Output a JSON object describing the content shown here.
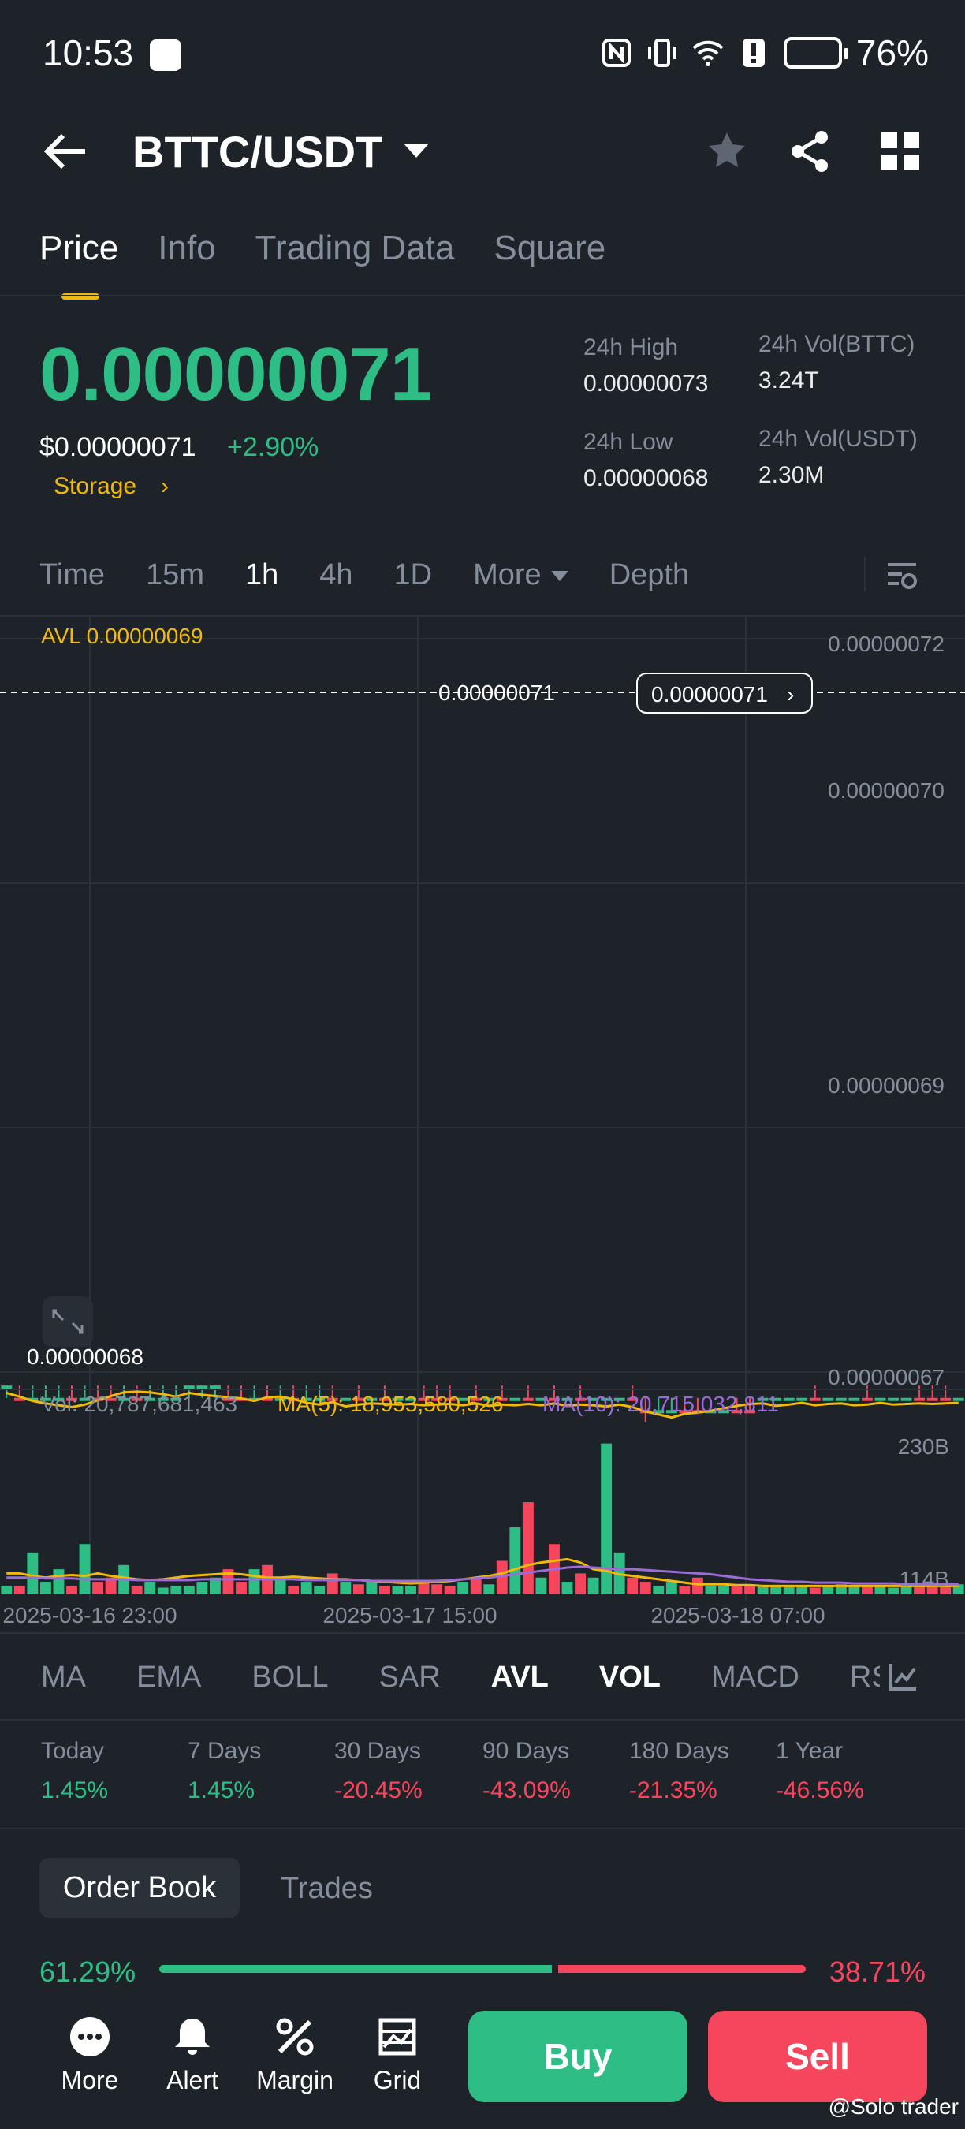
{
  "status_bar": {
    "time": "10:53",
    "battery": "76%"
  },
  "header": {
    "pair": "BTTC/USDT",
    "star_icon": "star-icon",
    "share_icon": "share-icon",
    "grid_icon": "grid-icon"
  },
  "tabs": [
    "Price",
    "Info",
    "Trading Data",
    "Square"
  ],
  "price": {
    "last": "0.00000071",
    "fiat": "$0.00000071",
    "change": "+2.90%",
    "storage": "Storage",
    "high_label": "24h High",
    "high": "0.00000073",
    "low_label": "24h Low",
    "low": "0.00000068",
    "vol_btt_label": "24h Vol(BTTC)",
    "vol_btt": "3.24T",
    "vol_usdt_label": "24h Vol(USDT)",
    "vol_usdt": "2.30M"
  },
  "intervals": [
    "Time",
    "15m",
    "1h",
    "4h",
    "1D",
    "More",
    "Depth"
  ],
  "chart_labels": {
    "avl": "AVL 0.00000069",
    "current_line": "0.00000071",
    "current_tag": "0.00000071",
    "low_marker": "0.00000068",
    "vol": "Vol: 20,787,681,463",
    "ma5": "MA(5): 18,953,580,526",
    "ma10": "MA(10): 20,715,032,811",
    "vol_axis_top": "230B",
    "vol_axis_mid": "114B",
    "x_labels": [
      "2025-03-16 23:00",
      "2025-03-17 15:00",
      "2025-03-18 07:00"
    ],
    "y_labels": [
      "0.00000072",
      "0.00000070",
      "0.00000069",
      "0.00000067"
    ]
  },
  "chart_data": {
    "type": "candlestick",
    "ylim": [
      6.69e-07,
      7.23e-08
    ],
    "levels": {
      "a": 6.8e-07,
      "b": 6.9e-07,
      "c": 7e-07,
      "d": 7.1e-07
    },
    "candles": [
      [
        "a",
        "a",
        "a",
        "b",
        "g"
      ],
      [
        "b",
        "a",
        "a",
        "b",
        "r"
      ],
      [
        "a",
        "b",
        "a",
        "b",
        "g"
      ],
      [
        "a",
        "b",
        "a",
        "b",
        "g"
      ],
      [
        "a",
        "b",
        "a",
        "b",
        "g"
      ],
      [
        "b",
        "a",
        "a",
        "b",
        "r"
      ],
      [
        "b",
        "b",
        "a",
        "b",
        "g"
      ],
      [
        "b",
        "a",
        "a",
        "b",
        "r"
      ],
      [
        "b",
        "a",
        "a",
        "b",
        "r"
      ],
      [
        "a",
        "b",
        "a",
        "b",
        "g"
      ],
      [
        "b",
        "a",
        "a",
        "b",
        "r"
      ],
      [
        "a",
        "b",
        "a",
        "b",
        "g"
      ],
      [
        "a",
        "b",
        "a",
        "b",
        "g"
      ],
      [
        "a",
        "b",
        "a",
        "b",
        "g"
      ],
      [
        "a",
        "a",
        "a",
        "b",
        "g"
      ],
      [
        "a",
        "a",
        "a",
        "b",
        "g"
      ],
      [
        "a",
        "a",
        "a",
        "b",
        "g"
      ],
      [
        "b",
        "b",
        "a",
        "b",
        "r"
      ],
      [
        "b",
        "a",
        "a",
        "b",
        "r"
      ],
      [
        "a",
        "b",
        "a",
        "b",
        "g"
      ],
      [
        "b",
        "a",
        "a",
        "b",
        "r"
      ],
      [
        "a",
        "b",
        "a",
        "b",
        "g"
      ],
      [
        "b",
        "a",
        "a",
        "b",
        "r"
      ],
      [
        "b",
        "b",
        "a",
        "b",
        "g"
      ],
      [
        "b",
        "b",
        "a",
        "b",
        "g"
      ],
      [
        "b",
        "a",
        "b",
        "b",
        "r"
      ],
      [
        "b",
        "b",
        "b",
        "b",
        "g"
      ],
      [
        "b",
        "a",
        "b",
        "b",
        "r"
      ],
      [
        "b",
        "b",
        "b",
        "b",
        "g"
      ],
      [
        "b",
        "a",
        "b",
        "b",
        "r"
      ],
      [
        "b",
        "b",
        "b",
        "b",
        "g"
      ],
      [
        "b",
        "b",
        "b",
        "b",
        "g"
      ],
      [
        "b",
        "a",
        "b",
        "b",
        "r"
      ],
      [
        "b",
        "a",
        "b",
        "b",
        "r"
      ],
      [
        "b",
        "a",
        "b",
        "b",
        "r"
      ],
      [
        "b",
        "b",
        "b",
        "b",
        "g"
      ],
      [
        "b",
        "a",
        "b",
        "b",
        "r"
      ],
      [
        "b",
        "b",
        "b",
        "b",
        "g"
      ],
      [
        "b",
        "a",
        "b",
        "b",
        "r"
      ],
      [
        "b",
        "b",
        "b",
        "b",
        "g"
      ],
      [
        "b",
        "a",
        "b",
        "b",
        "r"
      ],
      [
        "b",
        "b",
        "b",
        "b",
        "g"
      ],
      [
        "b",
        "a",
        "b",
        "b",
        "r"
      ],
      [
        "b",
        "b",
        "b",
        "b",
        "g"
      ],
      [
        "b",
        "a",
        "b",
        "b",
        "r"
      ],
      [
        "b",
        "b",
        "b",
        "b",
        "g"
      ],
      [
        "b",
        "b",
        "b",
        "b",
        "g"
      ],
      [
        "b",
        "b",
        "b",
        "b",
        "g"
      ],
      [
        "b",
        "a",
        "b",
        "b",
        "r"
      ],
      [
        "c",
        "b",
        "b",
        "d",
        "r"
      ],
      [
        "b",
        "c",
        "b",
        "b",
        "g"
      ],
      [
        "b",
        "c",
        "b",
        "b",
        "g"
      ],
      [
        "c",
        "b",
        "b",
        "b",
        "r"
      ],
      [
        "c",
        "b",
        "b",
        "b",
        "r"
      ],
      [
        "c",
        "c",
        "c",
        "c",
        "g"
      ],
      [
        "c",
        "c",
        "c",
        "c",
        "g"
      ],
      [
        "c",
        "b",
        "b",
        "c",
        "r"
      ],
      [
        "c",
        "b",
        "b",
        "c",
        "r"
      ],
      [
        "b",
        "b",
        "b",
        "b",
        "g"
      ],
      [
        "b",
        "b",
        "b",
        "b",
        "g"
      ],
      [
        "b",
        "b",
        "b",
        "b",
        "g"
      ],
      [
        "b",
        "b",
        "b",
        "b",
        "g"
      ],
      [
        "b",
        "a",
        "b",
        "b",
        "r"
      ],
      [
        "b",
        "b",
        "b",
        "b",
        "g"
      ],
      [
        "b",
        "b",
        "b",
        "b",
        "g"
      ],
      [
        "b",
        "b",
        "b",
        "b",
        "g"
      ],
      [
        "b",
        "a",
        "b",
        "b",
        "r"
      ],
      [
        "b",
        "b",
        "b",
        "b",
        "g"
      ],
      [
        "b",
        "b",
        "b",
        "b",
        "g"
      ],
      [
        "b",
        "b",
        "b",
        "b",
        "g"
      ],
      [
        "b",
        "a",
        "b",
        "b",
        "r"
      ],
      [
        "b",
        "a",
        "b",
        "b",
        "r"
      ],
      [
        "b",
        "a",
        "b",
        "b",
        "r"
      ],
      [
        "b",
        "b",
        "b",
        "b",
        "g"
      ]
    ],
    "avl_line": [
      0.6,
      0.9,
      1.25,
      1.45,
      1.6,
      1.75,
      1.55,
      1.2,
      0.85,
      0.55,
      0.5,
      0.55,
      0.7,
      0.9,
      0.6,
      0.75,
      0.85,
      0.95,
      1.05,
      1.25,
      0.95,
      0.9,
      1.1,
      1.4,
      1.55,
      1.35,
      1.7,
      1.55,
      1.45,
      1.5,
      1.55,
      1.5,
      1.6,
      1.55,
      1.5,
      1.6,
      1.45,
      1.65,
      1.55,
      1.6,
      1.5,
      1.6,
      1.45,
      1.65,
      1.55,
      1.6,
      1.7,
      1.55,
      1.75,
      2.1,
      2.35,
      2.6,
      2.3,
      2.2,
      2.05,
      1.85,
      1.65,
      1.5,
      1.45,
      1.65,
      1.55,
      1.4,
      1.6,
      1.5,
      1.45,
      1.6,
      1.55,
      1.4,
      1.55,
      1.5,
      1.45,
      1.5,
      1.45,
      1.4
    ],
    "volume": [
      10,
      10,
      50,
      15,
      30,
      10,
      60,
      15,
      20,
      35,
      10,
      15,
      8,
      10,
      10,
      15,
      20,
      30,
      15,
      30,
      35,
      20,
      10,
      15,
      10,
      25,
      15,
      12,
      15,
      10,
      10,
      10,
      15,
      12,
      10,
      15,
      20,
      12,
      40,
      80,
      110,
      20,
      60,
      15,
      25,
      20,
      180,
      50,
      20,
      15,
      10,
      15,
      10,
      20,
      10,
      10,
      10,
      10,
      10,
      10,
      10,
      10,
      8,
      10,
      12,
      10,
      10,
      10,
      8,
      10,
      12,
      10,
      10,
      12
    ],
    "ma_line1": [
      25,
      25,
      22,
      20,
      22,
      23,
      22,
      25,
      22,
      20,
      18,
      17,
      18,
      20,
      22,
      23,
      24,
      25,
      24,
      22,
      20,
      20,
      21,
      20,
      19,
      18,
      18,
      17,
      16,
      15,
      14,
      13,
      14,
      15,
      16,
      18,
      20,
      22,
      25,
      30,
      35,
      38,
      40,
      42,
      38,
      30,
      28,
      24,
      22,
      20,
      18,
      16,
      14,
      12,
      12,
      12,
      11,
      11,
      10,
      10,
      10,
      10,
      10,
      10,
      10,
      10,
      10,
      10,
      10,
      10,
      10,
      10,
      10,
      10
    ],
    "ma_line2": [
      20,
      20,
      20,
      19,
      19,
      19,
      18,
      18,
      18,
      18,
      17,
      17,
      17,
      17,
      17,
      18,
      18,
      18,
      18,
      18,
      18,
      18,
      18,
      17,
      17,
      17,
      17,
      17,
      16,
      16,
      16,
      16,
      16,
      16,
      17,
      18,
      19,
      20,
      22,
      24,
      26,
      28,
      30,
      32,
      33,
      32,
      31,
      30,
      30,
      29,
      28,
      27,
      26,
      25,
      24,
      22,
      20,
      18,
      17,
      16,
      15,
      15,
      14,
      14,
      14,
      13,
      13,
      13,
      13,
      12,
      12,
      12,
      12,
      12
    ]
  },
  "indicators": [
    "MA",
    "EMA",
    "BOLL",
    "SAR",
    "AVL",
    "VOL",
    "MACD",
    "RS"
  ],
  "performance": [
    {
      "label": "Today",
      "value": "1.45%",
      "dir": "up"
    },
    {
      "label": "7 Days",
      "value": "1.45%",
      "dir": "up"
    },
    {
      "label": "30 Days",
      "value": "-20.45%",
      "dir": "down"
    },
    {
      "label": "90 Days",
      "value": "-43.09%",
      "dir": "down"
    },
    {
      "label": "180 Days",
      "value": "-21.35%",
      "dir": "down"
    },
    {
      "label": "1 Year",
      "value": "-46.56%",
      "dir": "down"
    }
  ],
  "order_book": {
    "tab": "Order Book",
    "trades_tab": "Trades",
    "buy_pct": "61.29%",
    "sell_pct": "38.71%",
    "buy_ratio": 0.6129
  },
  "bottom": {
    "more": "More",
    "alert": "Alert",
    "margin": "Margin",
    "grid": "Grid",
    "buy": "Buy",
    "sell": "Sell"
  },
  "watermark": "@Solo trader",
  "colors": {
    "up": "#2ebd85",
    "down": "#f6465d",
    "accent": "#f0b90b",
    "bg": "#1e2329",
    "avl": "#f0b90b",
    "ma10": "#9b6bd6"
  }
}
